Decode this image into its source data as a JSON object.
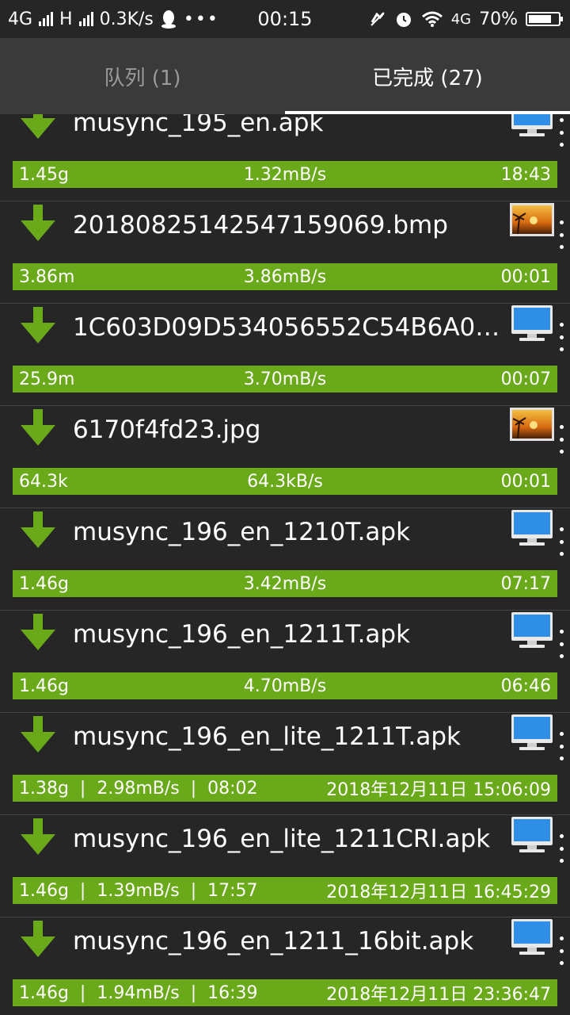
{
  "status": {
    "network1": "4G",
    "network2": "H",
    "speed": "0.3K/s",
    "time": "00:15",
    "network3": "4G",
    "battery": "70%",
    "battery_level": 0.7
  },
  "tabs": [
    {
      "label": "队列 (1)"
    },
    {
      "label": "已完成 (27)"
    }
  ],
  "items": [
    {
      "name": "musync_195_en.apk",
      "icon": "computer",
      "left": "1.45g",
      "mid": "1.32mB/s",
      "right": "18:43"
    },
    {
      "name": "20180825142547159069.bmp",
      "icon": "image",
      "left": "3.86m",
      "mid": "3.86mB/s",
      "right": "00:01"
    },
    {
      "name": "1C603D09D534056552C54B6A0…",
      "icon": "computer",
      "left": "25.9m",
      "mid": "3.70mB/s",
      "right": "00:07"
    },
    {
      "name": "6170f4fd23.jpg",
      "icon": "image",
      "left": "64.3k",
      "mid": "64.3kB/s",
      "right": "00:01"
    },
    {
      "name": "musync_196_en_1210T.apk",
      "icon": "computer",
      "left": "1.46g",
      "mid": "3.42mB/s",
      "right": "07:17"
    },
    {
      "name": "musync_196_en_1211T.apk",
      "icon": "computer",
      "left": "1.46g",
      "mid": "4.70mB/s",
      "right": "06:46"
    },
    {
      "name": "musync_196_en_lite_1211T.apk",
      "icon": "computer",
      "left": "1.38g  |  2.98mB/s  |  08:02",
      "mid": "",
      "right": "2018年12月11日 15:06:09"
    },
    {
      "name": "musync_196_en_lite_1211CRI.apk",
      "icon": "computer",
      "left": "1.46g  |  1.39mB/s  |  17:57",
      "mid": "",
      "right": "2018年12月11日 16:45:29"
    },
    {
      "name": "musync_196_en_1211_16bit.apk",
      "icon": "computer",
      "left": "1.46g  |  1.94mB/s  |  16:39",
      "mid": "",
      "right": "2018年12月11日 23:36:47"
    }
  ],
  "colors": {
    "background": "#262626",
    "tabbar": "#3a3a3a",
    "progress_green": "#6aaa1a",
    "download_arrow": "#6aaa1a",
    "monitor_blue": "#2f8fe6"
  }
}
